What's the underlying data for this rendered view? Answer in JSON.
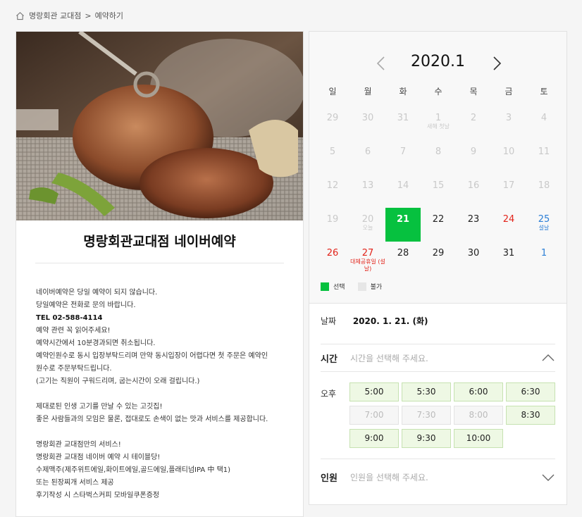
{
  "breadcrumb": {
    "home_icon": "home-icon",
    "store": "명랑회관 교대점",
    "separator": ">",
    "page": "예약하기"
  },
  "store": {
    "title": "명랑회관교대점 네이버예약",
    "photo": "grilled-pork-photo",
    "description": [
      {
        "text": "네이버예약은 당일 예약이 되지 않습니다.",
        "bold": false
      },
      {
        "text": "당일예약은 전화로 문의 바랍니다.",
        "bold": false
      },
      {
        "text": "TEL 02-588-4114",
        "bold": true
      },
      {
        "text": "예약 관련 꼭 읽어주세요!",
        "bold": false
      },
      {
        "text": "예약시간에서 10분경과되면 취소됩니다.",
        "bold": false
      },
      {
        "text": "예약인원수로 동시 입장부탁드리며 만약 동시입장이 어렵다면 첫 주문은 예약인",
        "bold": false
      },
      {
        "text": "원수로 주문부탁드립니다.",
        "bold": false
      },
      {
        "text": "(고기는 직원이 구워드리며, 굽는시간이 오래 걸립니다.)",
        "bold": false
      },
      {
        "text": "",
        "bold": false
      },
      {
        "text": "제대로된 인생 고기를 만날 수 있는 고깃집!",
        "bold": false
      },
      {
        "text": "좋은 사람들과의 모임은 물론, 접대로도 손색이 없는 맛과 서비스를 제공합니다.",
        "bold": false
      },
      {
        "text": "",
        "bold": false
      },
      {
        "text": "명랑회관 교대점만의 서비스!",
        "bold": false
      },
      {
        "text": "명랑회관 교대점 네이버 예약 시 테이블당!",
        "bold": false
      },
      {
        "text": "수제맥주(제주위트에일,화이트에일,골드에일,플래티넘IPA 中 택1)",
        "bold": false
      },
      {
        "text": "또는 된장찌개 서비스 제공",
        "bold": false
      },
      {
        "text": "후기작성 시 스타벅스커피 모바일쿠폰증정",
        "bold": false
      }
    ]
  },
  "calendar": {
    "month_label": "2020.1",
    "prev_icon": "chevron-left-icon",
    "next_icon": "chevron-right-icon",
    "weekdays": [
      "일",
      "월",
      "화",
      "수",
      "목",
      "금",
      "토"
    ],
    "days": [
      {
        "d": "29",
        "state": "disabled"
      },
      {
        "d": "30",
        "state": "disabled"
      },
      {
        "d": "31",
        "state": "disabled"
      },
      {
        "d": "1",
        "state": "disabled",
        "sub": "새해 첫날"
      },
      {
        "d": "2",
        "state": "disabled"
      },
      {
        "d": "3",
        "state": "disabled"
      },
      {
        "d": "4",
        "state": "disabled"
      },
      {
        "d": "5",
        "state": "disabled"
      },
      {
        "d": "6",
        "state": "disabled"
      },
      {
        "d": "7",
        "state": "disabled"
      },
      {
        "d": "8",
        "state": "disabled"
      },
      {
        "d": "9",
        "state": "disabled"
      },
      {
        "d": "10",
        "state": "disabled"
      },
      {
        "d": "11",
        "state": "disabled"
      },
      {
        "d": "12",
        "state": "disabled"
      },
      {
        "d": "13",
        "state": "disabled"
      },
      {
        "d": "14",
        "state": "disabled"
      },
      {
        "d": "15",
        "state": "disabled"
      },
      {
        "d": "16",
        "state": "disabled"
      },
      {
        "d": "17",
        "state": "disabled"
      },
      {
        "d": "18",
        "state": "disabled"
      },
      {
        "d": "19",
        "state": "disabled"
      },
      {
        "d": "20",
        "state": "disabled",
        "sub": "오늘"
      },
      {
        "d": "21",
        "state": "selected"
      },
      {
        "d": "22",
        "state": "normal"
      },
      {
        "d": "23",
        "state": "normal"
      },
      {
        "d": "24",
        "state": "holiday"
      },
      {
        "d": "25",
        "state": "saturday",
        "sub": "설날"
      },
      {
        "d": "26",
        "state": "holiday"
      },
      {
        "d": "27",
        "state": "holiday",
        "sub": "대체공휴일 (설날)"
      },
      {
        "d": "28",
        "state": "normal"
      },
      {
        "d": "29",
        "state": "normal"
      },
      {
        "d": "30",
        "state": "normal"
      },
      {
        "d": "31",
        "state": "normal"
      },
      {
        "d": "1",
        "state": "saturday"
      }
    ],
    "legend": [
      {
        "label": "선택",
        "color": "#06c13f"
      },
      {
        "label": "불가",
        "color": "#e6e6e6"
      }
    ]
  },
  "booking": {
    "date_label": "날짜",
    "date_value": "2020. 1. 21. (화)",
    "time_label": "시간",
    "time_placeholder": "시간을 선택해 주세요.",
    "ampm": "오후",
    "slots": [
      {
        "t": "5:00",
        "available": true
      },
      {
        "t": "5:30",
        "available": true
      },
      {
        "t": "6:00",
        "available": true
      },
      {
        "t": "6:30",
        "available": true
      },
      {
        "t": "7:00",
        "available": false
      },
      {
        "t": "7:30",
        "available": false
      },
      {
        "t": "8:00",
        "available": false
      },
      {
        "t": "8:30",
        "available": true
      },
      {
        "t": "9:00",
        "available": true
      },
      {
        "t": "9:30",
        "available": true
      },
      {
        "t": "10:00",
        "available": true
      }
    ],
    "people_label": "인원",
    "people_placeholder": "인원을 선택해 주세요."
  },
  "colors": {
    "selected": "#06c13f",
    "holiday": "#e2231a",
    "saturday": "#2b7ed6",
    "slot_bg": "#eef8e4"
  }
}
